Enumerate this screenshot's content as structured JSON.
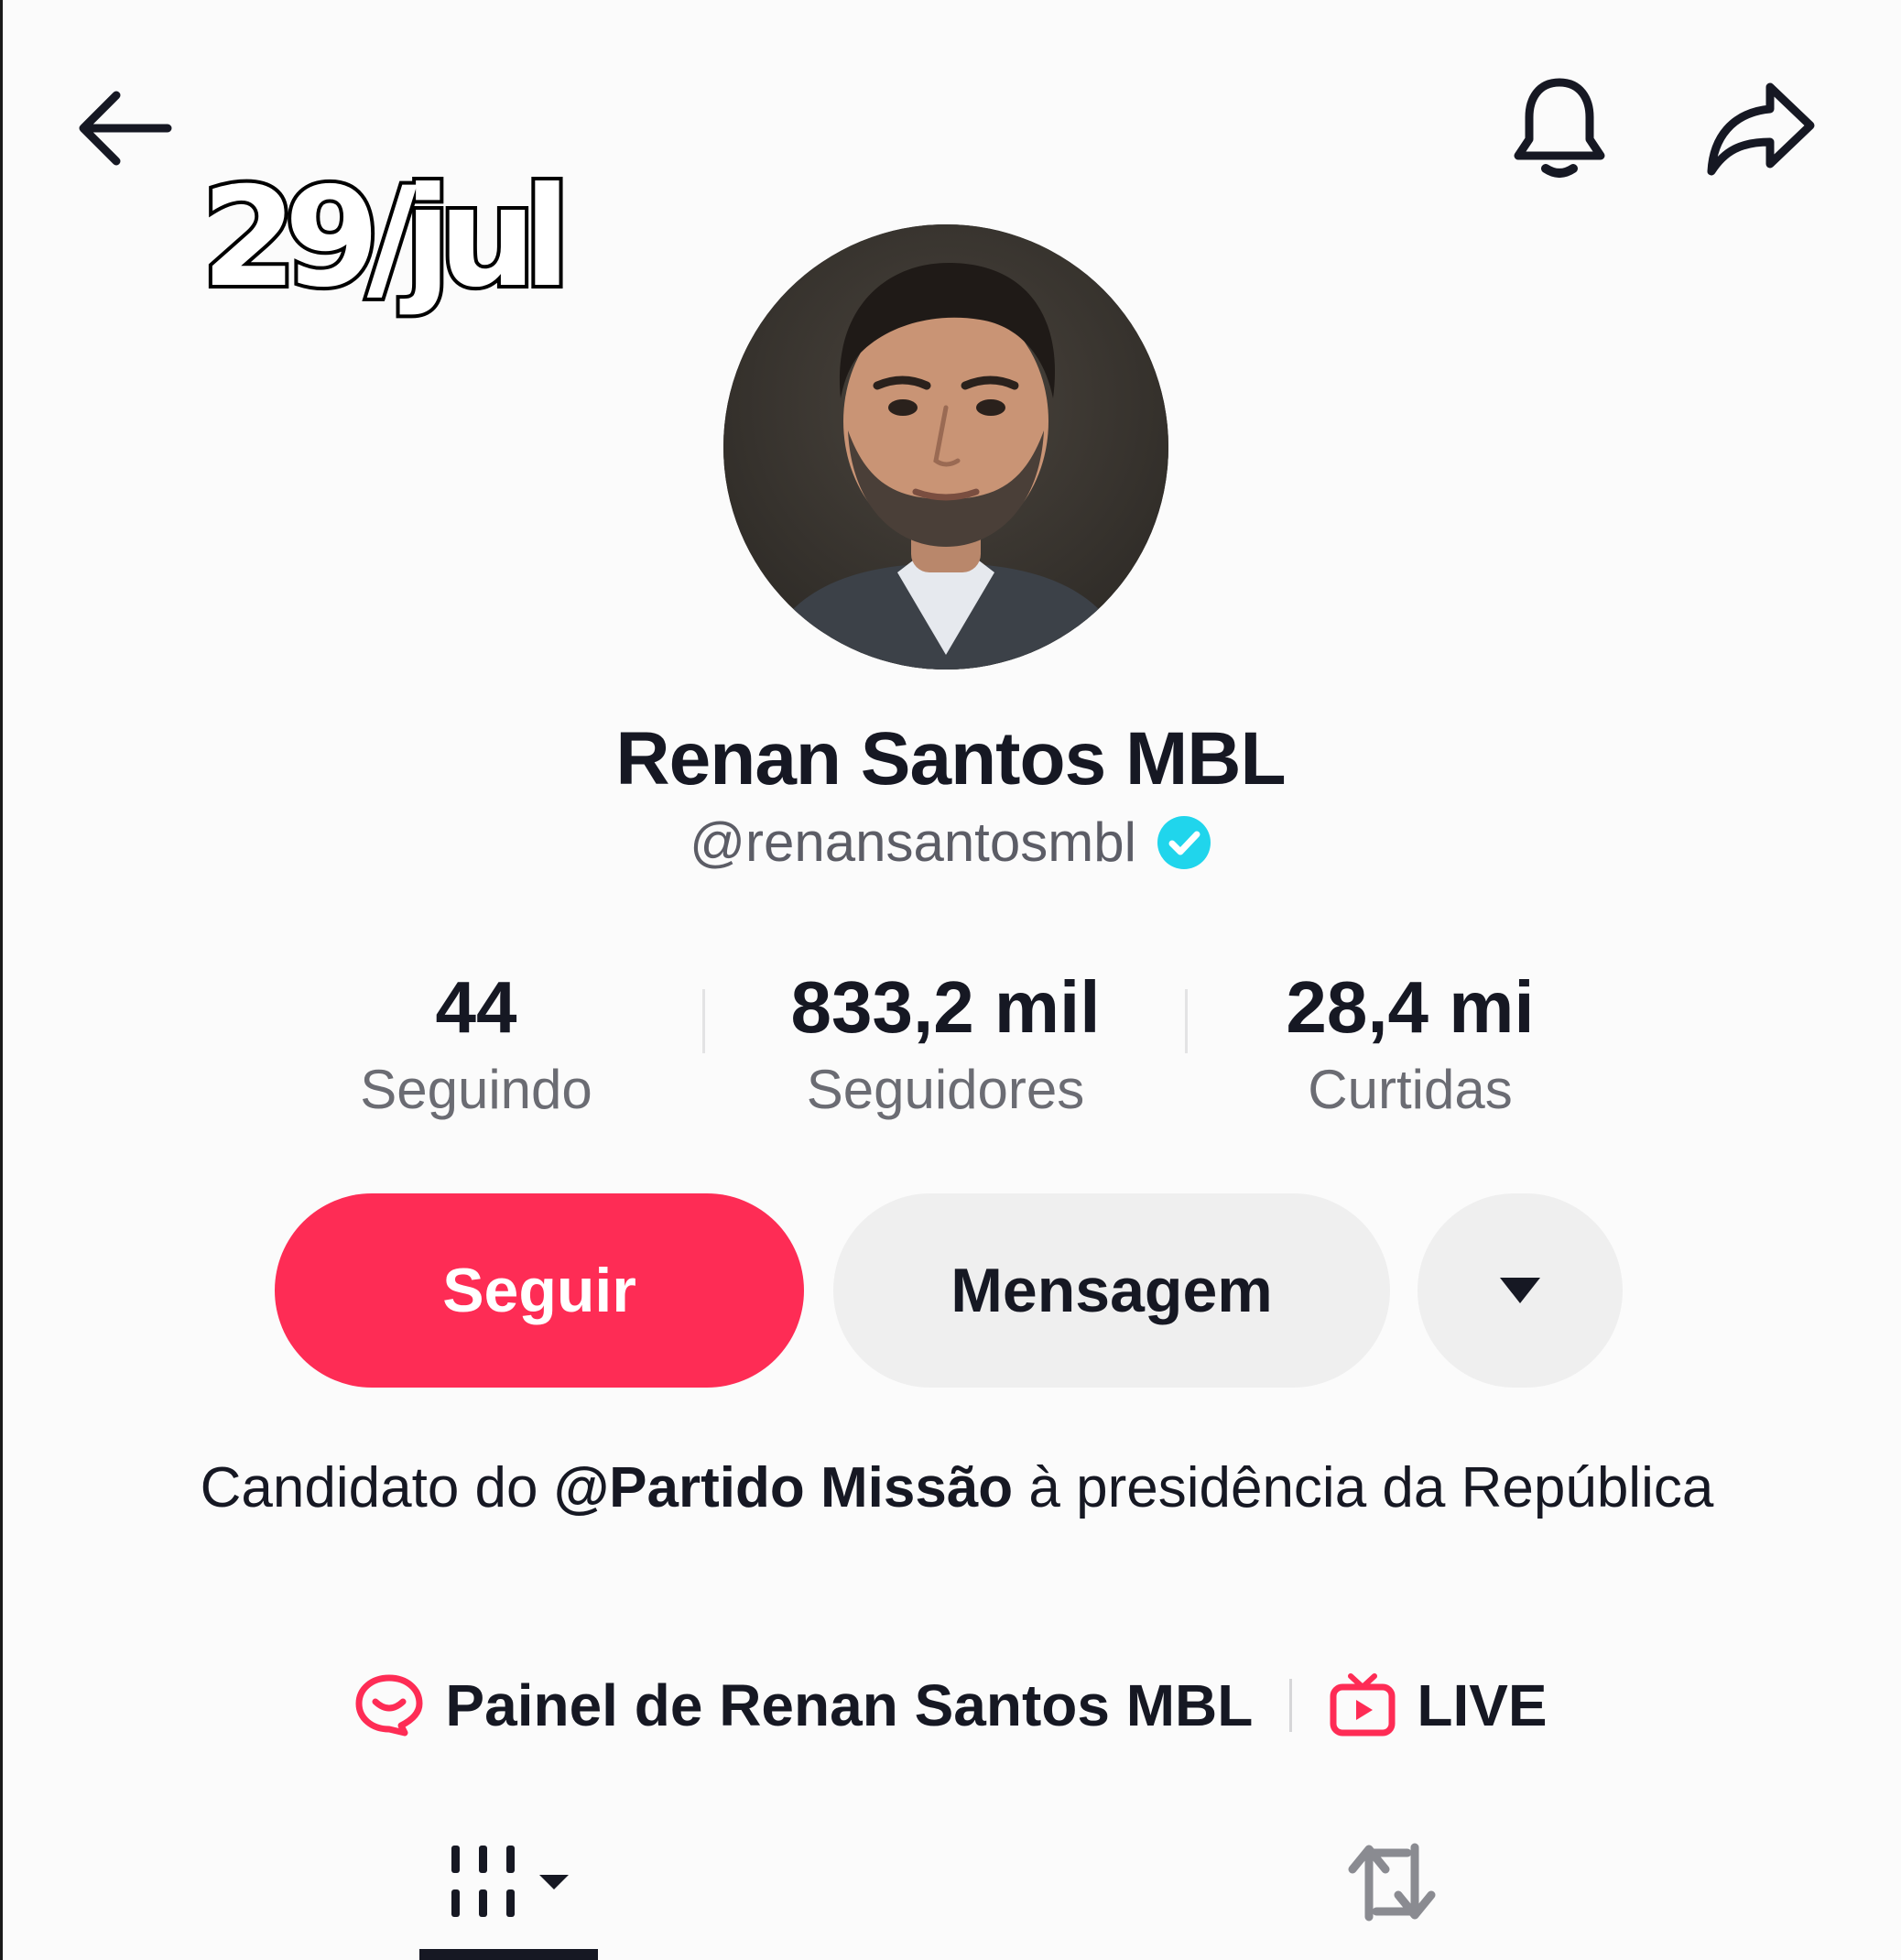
{
  "header": {
    "back_icon": "arrow-left-icon",
    "bell_icon": "bell-icon",
    "share_icon": "share-arrow-icon"
  },
  "overlay": {
    "date_text": "29/jul"
  },
  "profile": {
    "display_name": "Renan Santos MBL",
    "handle": "@renansantosmbl",
    "verified": true,
    "verified_color": "#20d5ec"
  },
  "stats": [
    {
      "value": "44",
      "label": "Seguindo"
    },
    {
      "value": "833,2 mil",
      "label": "Seguidores"
    },
    {
      "value": "28,4 mi",
      "label": "Curtidas"
    }
  ],
  "actions": {
    "follow_label": "Seguir",
    "message_label": "Mensagem",
    "more_icon": "caret-down-icon",
    "accent": "#fe2c55"
  },
  "bio": {
    "prefix": "Candidato do ",
    "mention": "@Partido Missão",
    "suffix": " à presidência da República"
  },
  "links": {
    "panel_label": "Painel de Renan Santos MBL",
    "live_label": "LIVE"
  },
  "tabs": {
    "videos_icon": "grid-icon",
    "reposts_icon": "repost-icon"
  }
}
